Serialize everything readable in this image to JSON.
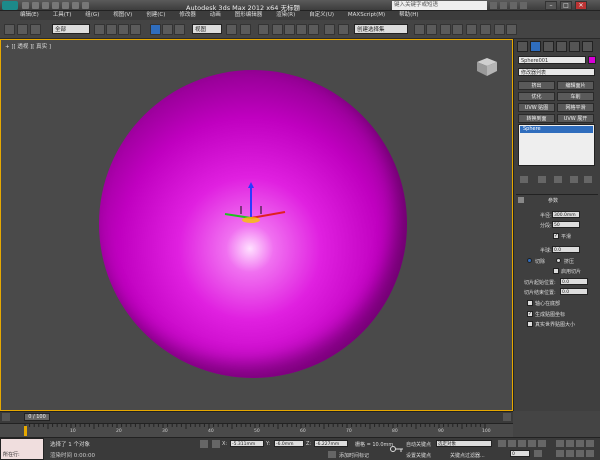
{
  "title": "Autodesk 3ds Max  2012 x64      无标题",
  "search_placeholder": "键入关键字或短语",
  "window_buttons": [
    "–",
    "□",
    "✕"
  ],
  "menu": [
    "编辑(E)",
    "工具(T)",
    "组(G)",
    "视图(V)",
    "创建(C)",
    "修改器",
    "动画",
    "图形编辑器",
    "渲染(R)",
    "自定义(U)",
    "MAXScript(M)",
    "帮助(H)"
  ],
  "toolbar": {
    "selection_filter": "全部",
    "coord_system": "视图",
    "named_selection": "创建选择集"
  },
  "viewport": {
    "label": "+ ][ 透视 ][ 真实 ]"
  },
  "command_panel": {
    "object_name": "Sphere001",
    "modifier_list": "修改器列表",
    "modifier_buttons": [
      "挤出",
      "编辑面片",
      "优化",
      "车削",
      "UVW 贴图",
      "网格平滑",
      "转换到面",
      "UVW 展开"
    ],
    "stack_item": "Sphere",
    "rollout_title": "参数",
    "radius_label": "半径:",
    "radius_value": "300.0mm",
    "segments_label": "分段:",
    "segments_value": "50",
    "smooth_label": "平滑",
    "hemisphere_label": "半球:",
    "hemisphere_value": "0.0",
    "chop_label": "切除",
    "squash_label": "挤压",
    "slice_on_label": "启用切片",
    "slice_from_label": "切片起始位置:",
    "slice_from_value": "0.0",
    "slice_to_label": "切片结束位置:",
    "slice_to_value": "0.0",
    "base_pivot_label": "轴心在底部",
    "gen_mapping_label": "生成贴图坐标",
    "real_world_label": "真实世界贴图大小"
  },
  "time_slider": {
    "label": "0 / 100"
  },
  "ruler_ticks": [
    "0",
    "10",
    "20",
    "30",
    "40",
    "50",
    "60",
    "70",
    "80",
    "90",
    "100"
  ],
  "status": {
    "maxscript_label": "所在行:",
    "selection_text": "选择了 1 个对象",
    "prompt_text": "渲染时间 0:00:00",
    "x_label": "X:",
    "x_value": "-5.311mm",
    "y_label": "Y:",
    "y_value": "-6.0mm",
    "z_label": "Z:",
    "z_value": "-6.227mm",
    "grid_label": "栅格 = 10.0mm",
    "add_time_tag": "添加时间标记",
    "auto_key": "自动关键点",
    "selected_dd": "选定对象",
    "set_key": "设置关键点",
    "key_filters": "关键点过滤器...",
    "frame_value": "0"
  }
}
